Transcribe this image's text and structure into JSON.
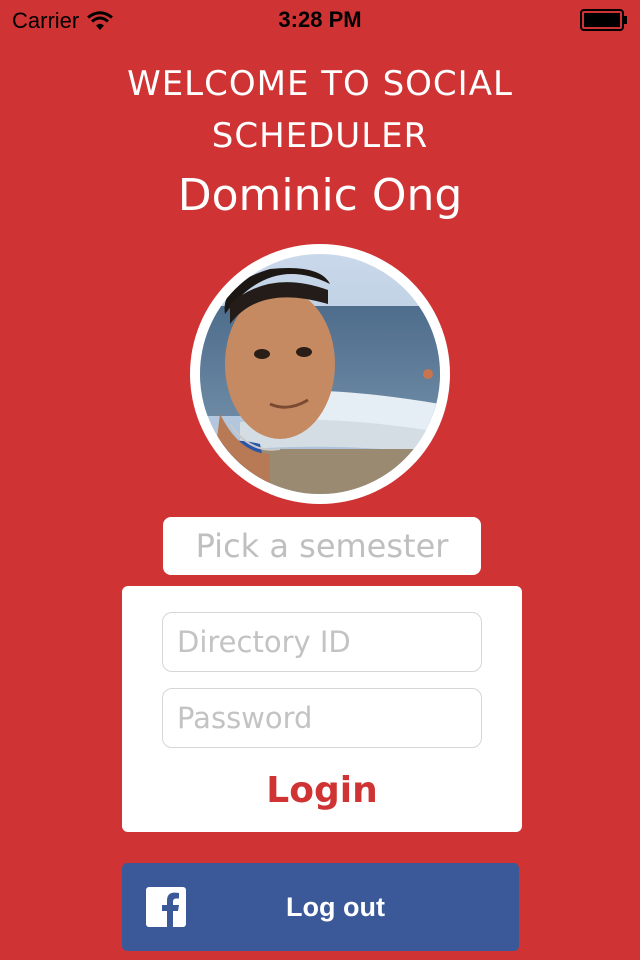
{
  "status_bar": {
    "carrier": "Carrier",
    "time": "3:28 PM"
  },
  "header": {
    "welcome_line1": "WELCOME TO SOCIAL",
    "welcome_line2": "SCHEDULER",
    "user_name": "Dominic Ong"
  },
  "semester_picker": {
    "placeholder": "Pick a semester"
  },
  "login_form": {
    "directory_id_placeholder": "Directory ID",
    "password_placeholder": "Password",
    "login_label": "Login"
  },
  "facebook": {
    "button_label": "Log out",
    "icon": "facebook-icon"
  },
  "colors": {
    "background": "#cf3333",
    "facebook_blue": "#3b5998",
    "login_text": "#cf3333"
  }
}
